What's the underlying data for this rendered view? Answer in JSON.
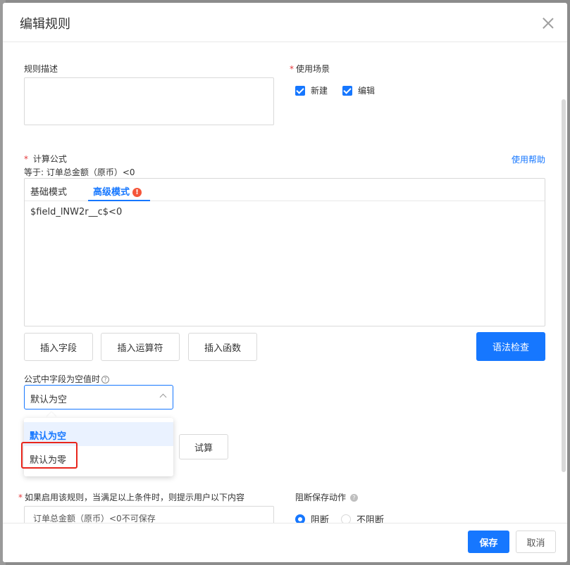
{
  "dialog": {
    "title": "编辑规则"
  },
  "description": {
    "label": "规则描述",
    "value": ""
  },
  "scenario": {
    "label": "使用场景",
    "options": [
      {
        "label": "新建",
        "checked": true
      },
      {
        "label": "编辑",
        "checked": true
      }
    ]
  },
  "formula": {
    "label": "计算公式",
    "equals_text": "等于: 订单总金额（原币）<0",
    "help_link": "使用帮助",
    "tabs": [
      {
        "label": "基础模式",
        "active": false
      },
      {
        "label": "高级模式",
        "active": true
      }
    ],
    "warning_glyph": "!",
    "code": "$field_lNW2r__c$<0"
  },
  "buttons": {
    "insert_field": "插入字段",
    "insert_operator": "插入运算符",
    "insert_function": "插入函数",
    "syntax_check": "语法检查",
    "trial": "试算"
  },
  "null_handling": {
    "label": "公式中字段为空值时",
    "help_glyph": "?",
    "selected": "默认为空",
    "options": [
      "默认为空",
      "默认为零"
    ]
  },
  "prompt": {
    "label": "如果启用该规则，当满足以上条件时，则提示用户以下内容",
    "value": "订单总金额（原币）<0不可保存"
  },
  "block": {
    "label": "阻断保存动作",
    "help_glyph": "?",
    "options": [
      {
        "label": "阻断",
        "selected": true
      },
      {
        "label": "不阻断",
        "selected": false
      }
    ]
  },
  "footer": {
    "save": "保存",
    "cancel": "取消"
  },
  "colors": {
    "primary": "#1677ff",
    "required": "#e4393c",
    "highlight": "#e8251c"
  },
  "icons": {
    "close": "close-icon",
    "check": "check-icon",
    "warning": "warning-icon",
    "help": "question-icon",
    "chevron": "chevron-up-icon"
  }
}
